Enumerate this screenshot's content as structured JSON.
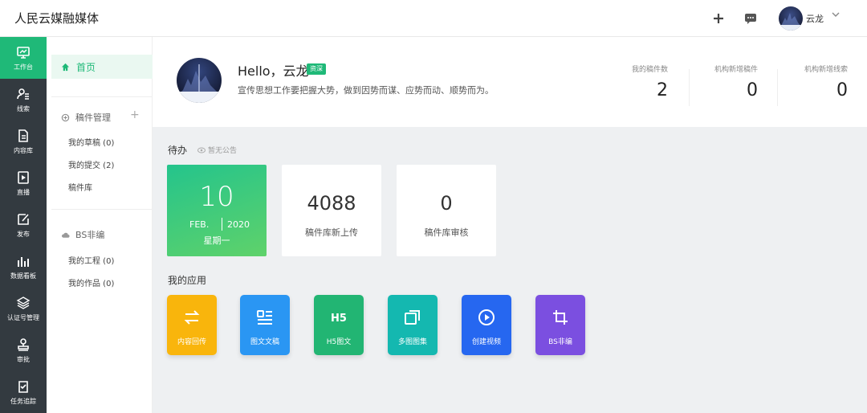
{
  "app": {
    "title": "人民云媒融媒体"
  },
  "user": {
    "name": "云龙"
  },
  "iconbar": [
    {
      "label": "工作台",
      "icon": "workbench-icon"
    },
    {
      "label": "线索",
      "icon": "clues-icon"
    },
    {
      "label": "内容库",
      "icon": "document-icon"
    },
    {
      "label": "直播",
      "icon": "live-icon"
    },
    {
      "label": "发布",
      "icon": "publish-icon"
    },
    {
      "label": "数据看板",
      "icon": "bar-chart-icon"
    },
    {
      "label": "认证号管理",
      "icon": "layers-icon"
    },
    {
      "label": "审批",
      "icon": "stamp-icon"
    },
    {
      "label": "任务追踪",
      "icon": "task-icon"
    }
  ],
  "nav": {
    "home": "首页",
    "manuscripts": {
      "title": "稿件管理",
      "items": [
        "我的草稿 (0)",
        "我的提交 (2)",
        "稿件库"
      ]
    },
    "bs": {
      "title": "BS非编",
      "items": [
        "我的工程 (0)",
        "我的作品 (0)"
      ]
    }
  },
  "header": {
    "hello": "Hello，云龙",
    "role": "资深",
    "slogan": "宣传思想工作要把握大势，做到因势而谋、应势而动、顺势而为。",
    "stats": [
      {
        "label": "我的稿件数",
        "value": "2"
      },
      {
        "label": "机构新增稿件",
        "value": "0"
      },
      {
        "label": "机构新增线索",
        "value": "0"
      }
    ]
  },
  "todo": {
    "title": "待办",
    "notice": "暂无公告",
    "date": {
      "day": "10",
      "month": "FEB.",
      "year": "2020",
      "weekday": "星期一"
    },
    "counts": [
      {
        "value": "4088",
        "label": "稿件库新上传"
      },
      {
        "value": "0",
        "label": "稿件库审核"
      }
    ]
  },
  "apps": {
    "title": "我的应用",
    "items": [
      {
        "label": "内容回传",
        "color": "#f9b50c",
        "icon": "swap-arrows-icon"
      },
      {
        "label": "图文文稿",
        "color": "#2a96f3",
        "icon": "article-icon"
      },
      {
        "label": "H5图文",
        "color": "#22b573",
        "icon": "h5-icon"
      },
      {
        "label": "多图图集",
        "color": "#14b8b0",
        "icon": "gallery-icon"
      },
      {
        "label": "创建视频",
        "color": "#2667f0",
        "icon": "play-circle-icon"
      },
      {
        "label": "BS非编",
        "color": "#7b4fe0",
        "icon": "crop-icon"
      }
    ]
  },
  "colors": {
    "accent": "#1fb978",
    "sidebar": "#333a40"
  }
}
